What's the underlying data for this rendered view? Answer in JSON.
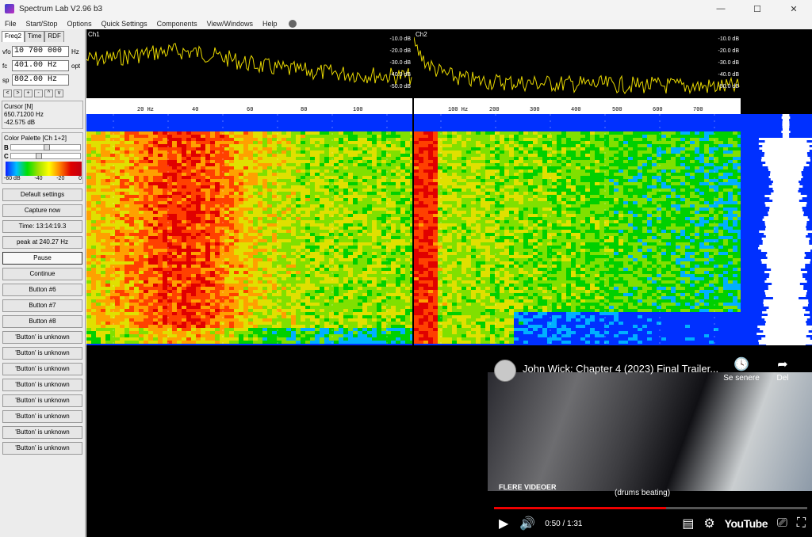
{
  "window": {
    "title": "Spectrum Lab V2.96 b3",
    "minimize": "—",
    "maximize": "☐",
    "close": "✕"
  },
  "menu": [
    "File",
    "Start/Stop",
    "Options",
    "Quick Settings",
    "Components",
    "View/Windows",
    "Help"
  ],
  "left": {
    "tabs": [
      "Freq2",
      "Time",
      "RDF"
    ],
    "vfo": {
      "label": "vfo",
      "value": "10 700 000",
      "unit": "Hz"
    },
    "fc": {
      "label": "fc",
      "value": "401.00 Hz",
      "unit": "opt"
    },
    "sp": {
      "label": "sp",
      "value": "802.00 Hz"
    },
    "arrows": [
      "<",
      ">",
      "+",
      "-",
      "^",
      "v"
    ],
    "cursor": {
      "title": "Cursor [N]",
      "freq": "650.71200 Hz",
      "level": "-42.575 dB"
    },
    "palette": {
      "title": "Color Palette [Ch 1+2]",
      "b_label": "B",
      "c_label": "C",
      "b_level": 0.5,
      "c_level": 0.38,
      "scale": [
        "-60 dB",
        "-40",
        "-20",
        "0"
      ]
    },
    "buttons": [
      "Default settings",
      "Capture now",
      "Time:  13:14:19.3",
      "peak at 240.27 Hz",
      "Pause",
      "Continue",
      "Button #6",
      "Button #7",
      "Button #8",
      "'Button' is unknown",
      "'Button' is unknown",
      "'Button' is unknown",
      "'Button' is unknown",
      "'Button' is unknown",
      "'Button' is unknown",
      "'Button' is unknown",
      "'Button' is unknown"
    ]
  },
  "spectrum": {
    "ch1": {
      "label": "Ch1",
      "db": [
        "-10.0 dB",
        "-20.0 dB",
        "-30.0 dB",
        "-40.0 dB",
        "-50.0 dB"
      ],
      "freqs": [
        "20 Hz",
        "40",
        "60",
        "80",
        "100"
      ]
    },
    "ch2": {
      "label": "Ch2",
      "db": [
        "-10.0 dB",
        "-20.0 dB",
        "-30.0 dB",
        "-40.0 dB",
        "-50.0 dB"
      ],
      "freqs": [
        "100 Hz",
        "200",
        "300",
        "400",
        "500",
        "600",
        "700"
      ]
    },
    "colors": {
      "trace": "#e8d800",
      "waterfall_base": "#0030ff"
    }
  },
  "video": {
    "title": "John Wick: Chapter 4 (2023) Final Trailer...",
    "watch_later_label": "Se senere",
    "share_label": "Del",
    "watermark": "FLERE VIDEOER",
    "subtitle": "(drums beating)",
    "time": "0:50 / 1:31",
    "progress": 0.55,
    "brand": "YouTube"
  }
}
